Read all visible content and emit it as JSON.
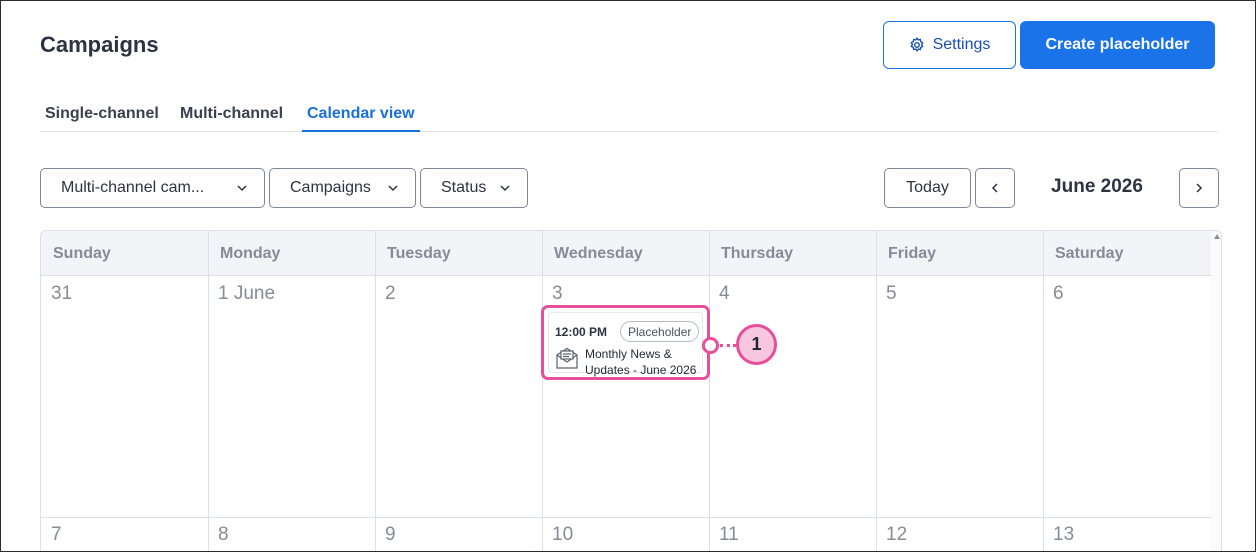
{
  "header": {
    "title": "Campaigns",
    "settings_label": "Settings",
    "create_label": "Create placeholder"
  },
  "tabs": [
    {
      "label": "Single-channel",
      "active": false
    },
    {
      "label": "Multi-channel",
      "active": false
    },
    {
      "label": "Calendar view",
      "active": true
    }
  ],
  "filters": {
    "channel_type": "Multi-channel cam...",
    "campaigns": "Campaigns",
    "status": "Status"
  },
  "calendar_nav": {
    "today_label": "Today",
    "month": "June 2026"
  },
  "weekdays": [
    "Sunday",
    "Monday",
    "Tuesday",
    "Wednesday",
    "Thursday",
    "Friday",
    "Saturday"
  ],
  "weeks": [
    [
      "31",
      "1 June",
      "2",
      "3",
      "4",
      "5",
      "6"
    ],
    [
      "7",
      "8",
      "9",
      "10",
      "11",
      "12",
      "13"
    ]
  ],
  "event": {
    "time": "12:00 PM",
    "badge": "Placeholder",
    "title": "Monthly News & Updates - June 2026",
    "icon": "envelope-icon"
  },
  "callout": {
    "number": "1"
  },
  "colors": {
    "accent": "#1a73e8",
    "highlight": "#e84f9a",
    "callout_fill": "#f7c6df"
  }
}
